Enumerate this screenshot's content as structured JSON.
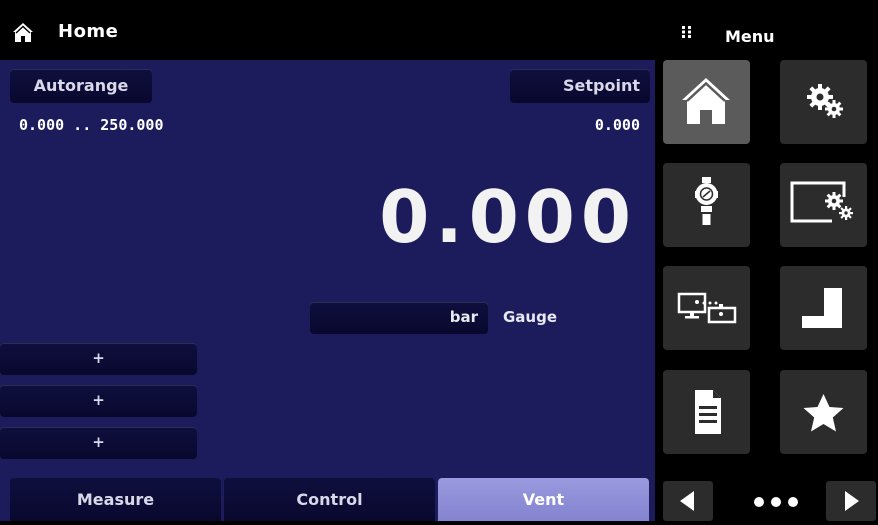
{
  "header": {
    "title": "Home",
    "icon": "home-icon"
  },
  "main": {
    "autorange_label": "Autorange",
    "setpoint_label": "Setpoint",
    "range": "0.000 .. 250.000",
    "setpoint_value": "0.000",
    "reading": "0.000",
    "units": "bar",
    "mode": "Gauge",
    "plus_buttons": [
      "+",
      "+",
      "+"
    ]
  },
  "tabs": [
    {
      "label": "Measure",
      "active": false
    },
    {
      "label": "Control",
      "active": false
    },
    {
      "label": "Vent",
      "active": true
    }
  ],
  "menu": {
    "title": "Menu",
    "icon": "grid-dots-icon",
    "tiles": [
      {
        "icon": "home-icon",
        "selected": true
      },
      {
        "icon": "gears-icon",
        "selected": false
      },
      {
        "icon": "pressure-sensor-icon",
        "selected": false
      },
      {
        "icon": "display-gears-icon",
        "selected": false
      },
      {
        "icon": "remote-connection-icon",
        "selected": false
      },
      {
        "icon": "step-icon",
        "selected": false
      },
      {
        "icon": "document-icon",
        "selected": false
      },
      {
        "icon": "star-icon",
        "selected": false
      }
    ],
    "pagination": {
      "icon_left": "chevron-left-icon",
      "icon_right": "chevron-right-icon",
      "pages": 3
    }
  },
  "colors": {
    "main_background": "#1c1c5c",
    "button_background": "#0a0a34",
    "active_tab": "#8f8fd8",
    "tile_background": "#2c2c2c",
    "tile_selected": "#5b5b5b"
  }
}
